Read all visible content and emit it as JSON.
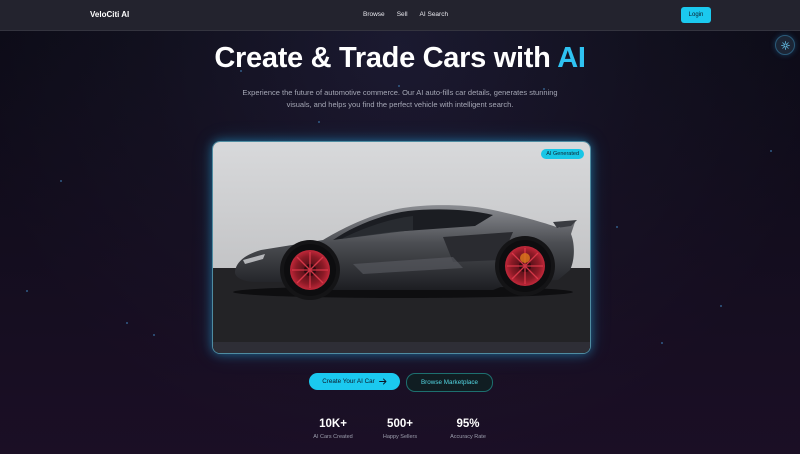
{
  "nav": {
    "brand": "VeloCiti AI",
    "links": [
      "Browse",
      "Sell",
      "AI Search"
    ],
    "login_label": "Login"
  },
  "hero": {
    "title_main": "Create & Trade Cars with ",
    "title_accent": "AI",
    "subtitle": "Experience the future of automotive commerce. Our AI auto-fills car details, generates stunning visuals, and helps you find the perfect vehicle with intelligent search."
  },
  "card": {
    "badge": "AI Generated"
  },
  "buttons": {
    "primary_label": "Create Your AI Car",
    "primary_icon": "arrow-right-icon",
    "secondary_label": "Browse Marketplace"
  },
  "stats": [
    {
      "value": "10K+",
      "label": "AI Cars Created"
    },
    {
      "value": "500+",
      "label": "Happy Sellers"
    },
    {
      "value": "95%",
      "label": "Accuracy Rate"
    }
  ],
  "colors": {
    "accent": "#1bc9ef",
    "background": "#10101d",
    "nav": "#23232e"
  }
}
